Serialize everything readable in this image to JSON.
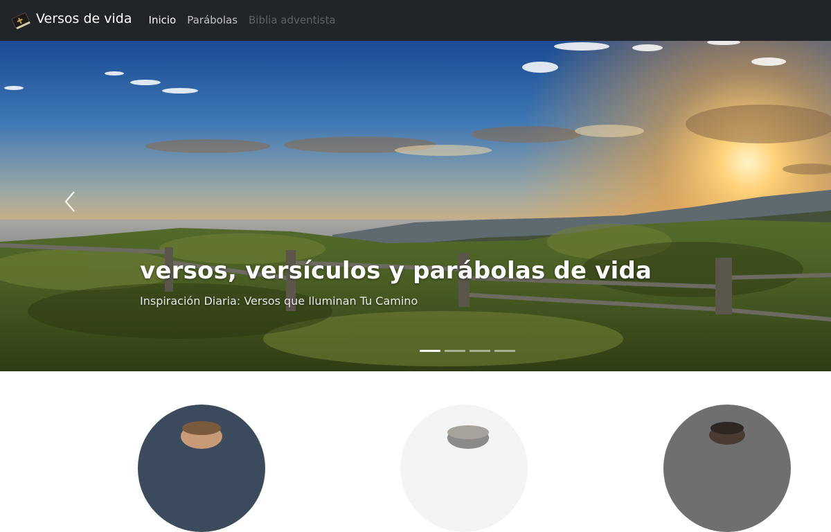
{
  "navbar": {
    "brand": "Versos de vida",
    "brand_icon": "bible-book-icon",
    "items": [
      {
        "label": "Inicio",
        "state": "active"
      },
      {
        "label": "Parábolas",
        "state": "normal"
      },
      {
        "label": "Biblia adventista",
        "state": "disabled"
      }
    ]
  },
  "carousel": {
    "title": "versos, versículos y parábolas de vida",
    "subtitle": "Inspiración Diaria: Versos que Iluminan Tu Camino",
    "indicator_count": 4,
    "active_slide": 1,
    "prev_icon": "chevron-left-icon"
  },
  "featured": {
    "avatars": [
      {
        "icon": "person-photo"
      },
      {
        "icon": "person-photo"
      },
      {
        "icon": "person-photo"
      }
    ]
  },
  "colors": {
    "navbar_bg": "#212529",
    "sky_top": "#1d4f9c",
    "sunset": "#f0a63c"
  }
}
